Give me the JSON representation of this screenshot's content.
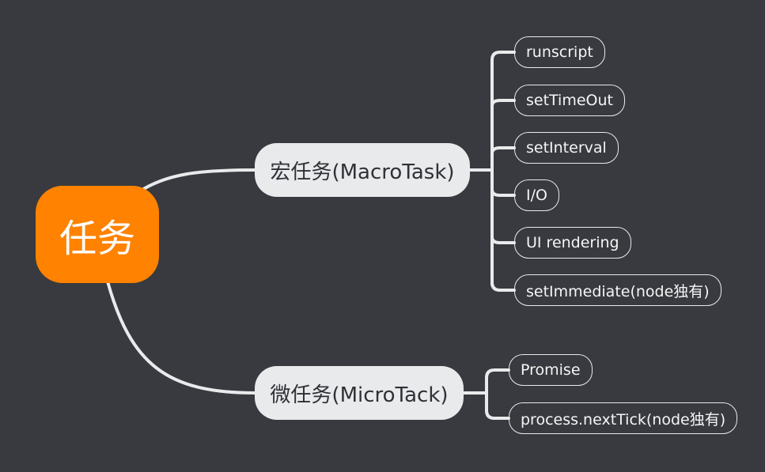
{
  "mindmap": {
    "root": {
      "label": "任务"
    },
    "macro": {
      "label": "宏任务(MacroTask)",
      "items": [
        "runscript",
        "setTimeOut",
        "setInterval",
        "I/O",
        "UI rendering",
        "setImmediate(node独有)"
      ]
    },
    "micro": {
      "label": "微任务(MicroTack)",
      "items": [
        "Promise",
        "process.nextTick(node独有)"
      ]
    }
  },
  "colors": {
    "background": "#383a3f",
    "root_fill": "#ff8200",
    "branch_fill": "#e9eaec",
    "connector": "#e9eaec"
  }
}
